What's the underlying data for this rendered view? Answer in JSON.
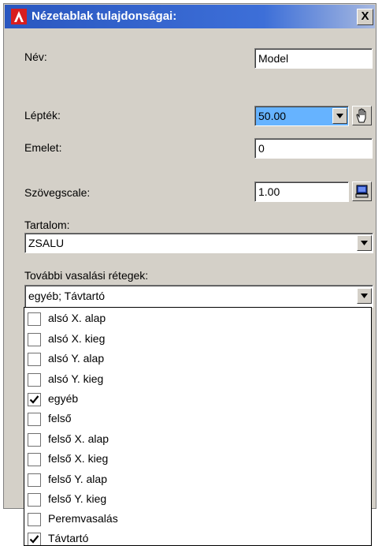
{
  "dialog": {
    "title": "Nézetablak tulajdonságai:",
    "close_label": "X"
  },
  "name_field": {
    "label": "Név:",
    "value": "Model"
  },
  "scale_field": {
    "label": "Lépték:",
    "value": "50.00"
  },
  "floor_field": {
    "label": "Emelet:",
    "value": "0"
  },
  "text_scale_field": {
    "label": "Szövegscale:",
    "value": "1.00"
  },
  "content": {
    "label": "Tartalom:",
    "value": "ZSALU"
  },
  "layers": {
    "label": "További vasalási rétegek:",
    "value": "egyéb; Távtartó",
    "items": [
      {
        "label": "alsó X. alap",
        "checked": false
      },
      {
        "label": "alsó X. kieg",
        "checked": false
      },
      {
        "label": "alsó Y. alap",
        "checked": false
      },
      {
        "label": "alsó Y. kieg",
        "checked": false
      },
      {
        "label": "egyéb",
        "checked": true
      },
      {
        "label": "felső",
        "checked": false
      },
      {
        "label": "felső X. alap",
        "checked": false
      },
      {
        "label": "felső X. kieg",
        "checked": false
      },
      {
        "label": "felső Y. alap",
        "checked": false
      },
      {
        "label": "felső Y. kieg",
        "checked": false
      },
      {
        "label": "Peremvasalás",
        "checked": false
      },
      {
        "label": "Távtartó",
        "checked": true
      }
    ]
  },
  "colors": {
    "title_bar": "#2a57c0",
    "dialog_bg": "#d4d0c8",
    "selection": "#66b3ff"
  },
  "icons": [
    "app-icon",
    "close-icon",
    "hand-icon",
    "screen-icon",
    "chevron-down-icon",
    "checkmark-icon"
  ]
}
